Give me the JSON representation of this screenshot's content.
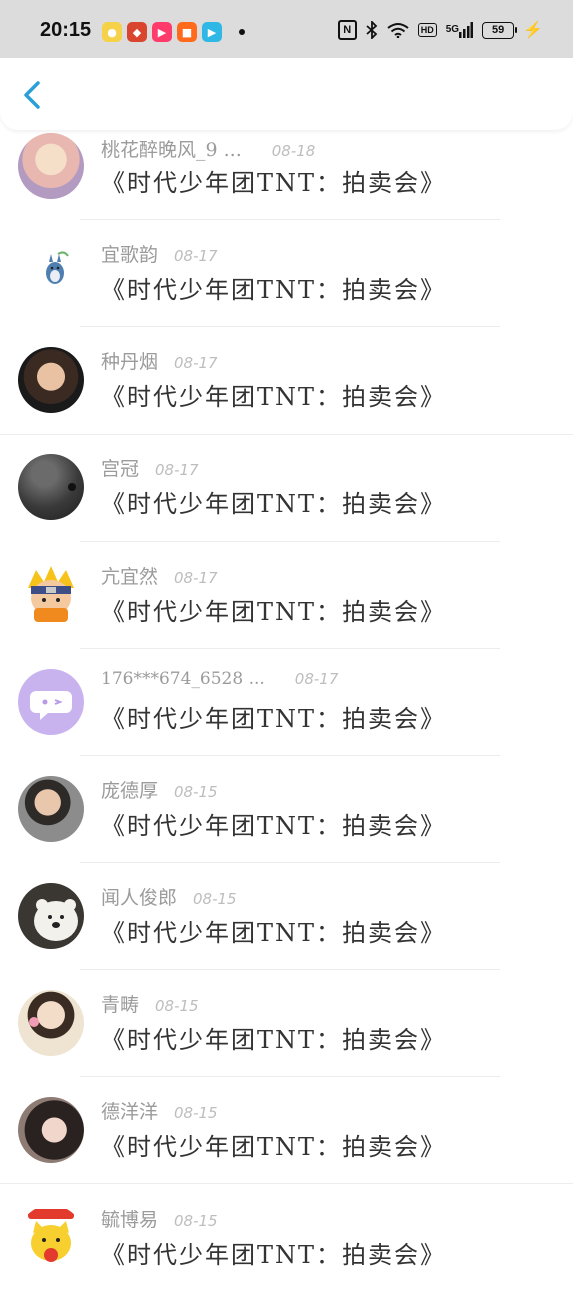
{
  "status_bar": {
    "time": "20:15",
    "battery": "59",
    "network": "5G",
    "hd": "HD",
    "nfc": "N"
  },
  "header": {
    "back_icon": "chevron-left-icon",
    "accent": "#2a9fd8"
  },
  "items": [
    {
      "name": "桃花醉晚风_9 ...",
      "date": "08-18",
      "title": "《时代少年团TNT：拍卖会》"
    },
    {
      "name": "宜歌韵",
      "date": "08-17",
      "title": "《时代少年团TNT：拍卖会》"
    },
    {
      "name": "种丹烟",
      "date": "08-17",
      "title": "《时代少年团TNT：拍卖会》"
    },
    {
      "name": "宫冠",
      "date": "08-17",
      "title": "《时代少年团TNT：拍卖会》"
    },
    {
      "name": "亢宜然",
      "date": "08-17",
      "title": "《时代少年团TNT：拍卖会》"
    },
    {
      "name": "176***674_6528 ...",
      "date": "08-17",
      "title": "《时代少年团TNT：拍卖会》"
    },
    {
      "name": "庞德厚",
      "date": "08-15",
      "title": "《时代少年团TNT：拍卖会》"
    },
    {
      "name": "闻人俊郎",
      "date": "08-15",
      "title": "《时代少年团TNT：拍卖会》"
    },
    {
      "name": "青畴",
      "date": "08-15",
      "title": "《时代少年团TNT：拍卖会》"
    },
    {
      "name": "德洋洋",
      "date": "08-15",
      "title": "《时代少年团TNT：拍卖会》"
    },
    {
      "name": "毓博易",
      "date": "08-15",
      "title": "《时代少年团TNT：拍卖会》"
    }
  ]
}
